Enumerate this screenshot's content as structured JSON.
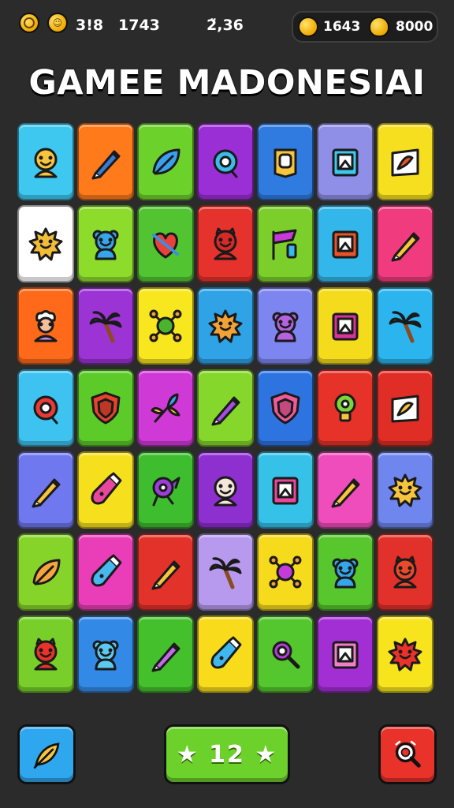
{
  "hud": {
    "left_value_1": "3!8",
    "left_value_2": "1743",
    "center_value": "2̈,36",
    "coins_value": "1643",
    "gems_value": "8000"
  },
  "title": "GAMEE MADONESIAI",
  "board": {
    "rows": [
      [
        {
          "color": "#3ec7ef",
          "icon": "face-icon",
          "fg": "#f6c43d"
        },
        {
          "color": "#ff7a1a",
          "icon": "pen-icon",
          "fg": "#3a7bd5"
        },
        {
          "color": "#6dd12b",
          "icon": "leaf-icon",
          "fg": "#3aa0ee"
        },
        {
          "color": "#9b2fd6",
          "icon": "ring-icon",
          "fg": "#3bbbe8"
        },
        {
          "color": "#2f7be0",
          "icon": "badge-icon",
          "fg": "#f6c43d"
        },
        {
          "color": "#8f8fe8",
          "icon": "frame-icon",
          "fg": "#3ec7ef"
        },
        {
          "color": "#f6df1e",
          "icon": "picture-icon",
          "fg": "#e8542a"
        }
      ],
      [
        {
          "color": "#ffffff",
          "icon": "sun-icon",
          "fg": "#f2bd36"
        },
        {
          "color": "#8ddc2c",
          "icon": "bear-icon",
          "fg": "#36a6ea"
        },
        {
          "color": "#52c432",
          "icon": "heart-icon",
          "fg": "#e9423a"
        },
        {
          "color": "#e6322c",
          "icon": "monster-icon",
          "fg": "#d72a26"
        },
        {
          "color": "#7ccf2b",
          "icon": "flag-icon",
          "fg": "#c53bd8"
        },
        {
          "color": "#33b6ea",
          "icon": "frame-icon",
          "fg": "#e8542a"
        },
        {
          "color": "#f03c7e",
          "icon": "pen-icon",
          "fg": "#f6c43d"
        }
      ],
      [
        {
          "color": "#ff6a1a",
          "icon": "chef-icon",
          "fg": "#c48ae8"
        },
        {
          "color": "#9c33d4",
          "icon": "palm-icon",
          "fg": "#3fbf4a"
        },
        {
          "color": "#f8e61e",
          "icon": "bug-icon",
          "fg": "#4ab42e"
        },
        {
          "color": "#30a2e6",
          "icon": "sun-icon",
          "fg": "#f2a334"
        },
        {
          "color": "#7d86f0",
          "icon": "bear-icon",
          "fg": "#b463e0"
        },
        {
          "color": "#f4dc1c",
          "icon": "frame-icon",
          "fg": "#d7349a"
        },
        {
          "color": "#2cb4ee",
          "icon": "palm-icon",
          "fg": "#6fcf2e"
        }
      ],
      [
        {
          "color": "#3ec2ef",
          "icon": "ring-icon",
          "fg": "#e83a3a"
        },
        {
          "color": "#5ccb29",
          "icon": "shield-icon",
          "fg": "#e8422f"
        },
        {
          "color": "#cf3ad6",
          "icon": "flower-icon",
          "fg": "#3aa0ee"
        },
        {
          "color": "#86d72b",
          "icon": "pen-icon",
          "fg": "#a44ee0"
        },
        {
          "color": "#2e74e0",
          "icon": "shield-icon",
          "fg": "#f05a9a"
        },
        {
          "color": "#e63228",
          "icon": "bulb-icon",
          "fg": "#7fd33b"
        },
        {
          "color": "#e02e26",
          "icon": "picture-icon",
          "fg": "#f6c43d"
        }
      ],
      [
        {
          "color": "#6f78ee",
          "icon": "pen-icon",
          "fg": "#f6c43d"
        },
        {
          "color": "#f6e01e",
          "icon": "bottle-icon",
          "fg": "#e8479c"
        },
        {
          "color": "#3ebd2f",
          "icon": "bird-icon",
          "fg": "#9b3fd8"
        },
        {
          "color": "#8e2fcf",
          "icon": "face-icon",
          "fg": "#f4e6d8"
        },
        {
          "color": "#36c1e8",
          "icon": "frame-icon",
          "fg": "#e8479c"
        },
        {
          "color": "#ef4dbc",
          "icon": "pen-icon",
          "fg": "#f6c43d"
        },
        {
          "color": "#6f86ee",
          "icon": "sun-icon",
          "fg": "#f6c43d"
        }
      ],
      [
        {
          "color": "#86d42a",
          "icon": "leaf-icon",
          "fg": "#f6a53d"
        },
        {
          "color": "#e93eb8",
          "icon": "bottle-icon",
          "fg": "#48b7ee"
        },
        {
          "color": "#e3322a",
          "icon": "pen-icon",
          "fg": "#f6c43d"
        },
        {
          "color": "#b79aee",
          "icon": "palm-icon",
          "fg": "#4ab42e"
        },
        {
          "color": "#f6da1c",
          "icon": "bug-icon",
          "fg": "#c53bd8"
        },
        {
          "color": "#58c72e",
          "icon": "bear-icon",
          "fg": "#36a6ea"
        },
        {
          "color": "#e2302a",
          "icon": "monster-icon",
          "fg": "#e84a2c"
        }
      ],
      [
        {
          "color": "#78cf2a",
          "icon": "monster-icon",
          "fg": "#e8322a"
        },
        {
          "color": "#3389e6",
          "icon": "bear-icon",
          "fg": "#5ccaf0"
        },
        {
          "color": "#45c02d",
          "icon": "pen-icon",
          "fg": "#c26ae8"
        },
        {
          "color": "#f8dc1c",
          "icon": "bottle-icon",
          "fg": "#3fb8ee"
        },
        {
          "color": "#55c72e",
          "icon": "magnifier-icon",
          "fg": "#b53ed8"
        },
        {
          "color": "#a12fd4",
          "icon": "frame-icon",
          "fg": "#ef7fc6"
        },
        {
          "color": "#f8e41c",
          "icon": "sun-icon",
          "fg": "#e8322a"
        }
      ]
    ]
  },
  "bottom": {
    "counter_label": "★ 12 ★",
    "left_button_color": "#2ea7ee",
    "center_button_color": "#6dd12b",
    "right_button_color": "#e8322a"
  }
}
